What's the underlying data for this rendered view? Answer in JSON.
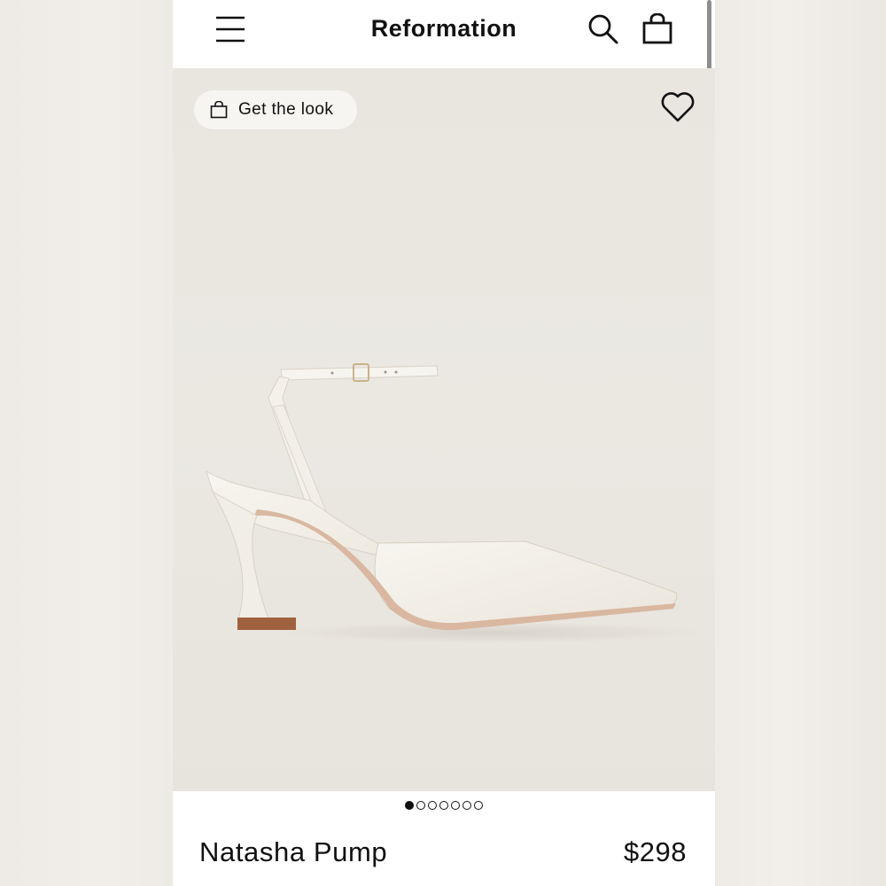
{
  "header": {
    "brand": "Reformation",
    "menu_icon": "hamburger-menu-icon",
    "search_icon": "search-icon",
    "bag_icon": "shopping-bag-icon"
  },
  "gallery": {
    "get_the_look_label": "Get the look",
    "get_the_look_icon": "shopping-bag-icon",
    "favorite_icon": "heart-icon",
    "image_count": 7,
    "active_index": 0
  },
  "product": {
    "name": "Natasha Pump",
    "price": "$298"
  },
  "colors": {
    "background": "#ebe8e2",
    "text": "#111111",
    "pill": "#f6f5f2",
    "shoe": "#f4f1ea",
    "heel_tip": "#a0623e"
  }
}
